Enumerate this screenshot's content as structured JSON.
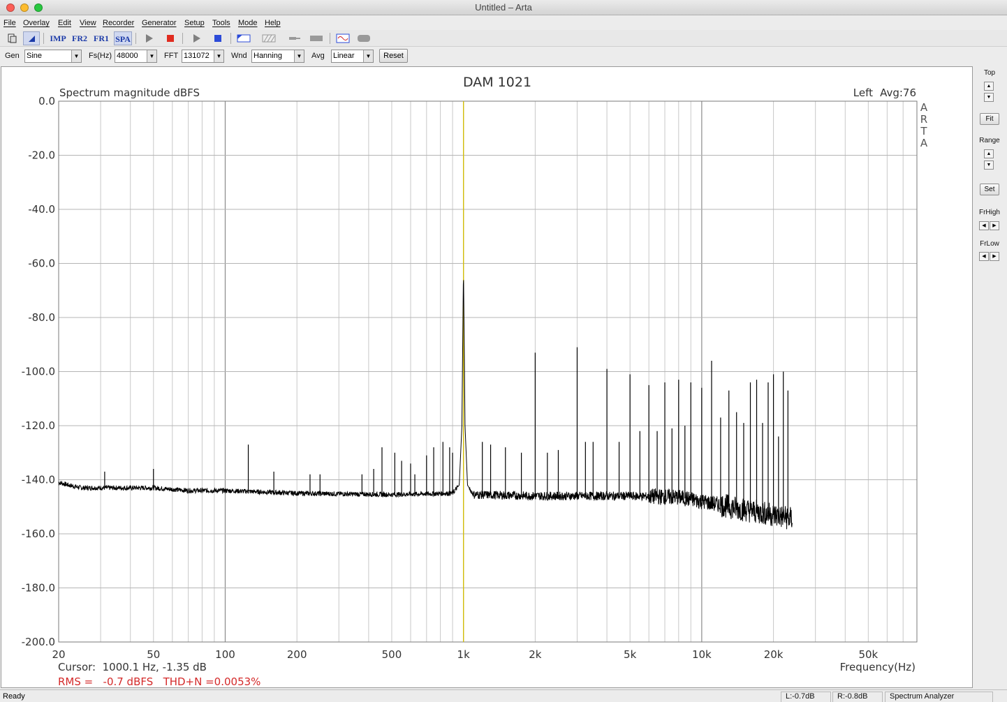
{
  "window": {
    "title": "Untitled – Arta"
  },
  "menu": [
    "File",
    "Overlay",
    "Edit",
    "View",
    "Recorder",
    "Generator",
    "Setup",
    "Tools",
    "Mode",
    "Help"
  ],
  "toolbar": {
    "buttons": [
      "new-icon",
      "pointer-icon",
      "IMP",
      "FR2",
      "FR1",
      "SPA",
      "play-icon",
      "stop-icon",
      "play-icon",
      "stop-icon",
      "abc-icon",
      "hatch-icon",
      "probe-icon",
      "bar-icon",
      "scope-icon",
      "record-icon"
    ],
    "imp": "IMP",
    "fr2": "FR2",
    "fr1": "FR1",
    "spa": "SPA"
  },
  "controls": {
    "gen_label": "Gen",
    "gen_value": "Sine",
    "fs_label": "Fs(Hz)",
    "fs_value": "48000",
    "fft_label": "FFT",
    "fft_value": "131072",
    "wnd_label": "Wnd",
    "wnd_value": "Hanning",
    "avg_label": "Avg",
    "avg_value": "Linear",
    "reset_label": "Reset"
  },
  "right_panel": {
    "top_label": "Top",
    "fit_label": "Fit",
    "range_label": "Range",
    "set_label": "Set",
    "frhigh_label": "FrHigh",
    "frlow_label": "FrLow"
  },
  "status": {
    "ready": "Ready",
    "left_level": "L:-0.7dB",
    "right_level": "R:-0.8dB",
    "mode": "Spectrum Analyzer"
  },
  "chart_data": {
    "type": "line",
    "title": "DAM 1021",
    "ylabel": "Spectrum magnitude dBFS",
    "xlabel": "Frequency(Hz)",
    "channel_label": "Left",
    "avg_label": "Avg:76",
    "watermark": [
      "A",
      "R",
      "T",
      "A"
    ],
    "x_scale": "log",
    "xlim": [
      20,
      80000
    ],
    "ylim": [
      -200,
      0
    ],
    "y_ticks": [
      "0.0",
      "-20.0",
      "-40.0",
      "-60.0",
      "-80.0",
      "-100.0",
      "-120.0",
      "-140.0",
      "-160.0",
      "-180.0",
      "-200.0"
    ],
    "x_ticks": [
      {
        "v": 20,
        "label": "20"
      },
      {
        "v": 50,
        "label": "50"
      },
      {
        "v": 100,
        "label": "100"
      },
      {
        "v": 200,
        "label": "200"
      },
      {
        "v": 500,
        "label": "500"
      },
      {
        "v": 1000,
        "label": "1k"
      },
      {
        "v": 2000,
        "label": "2k"
      },
      {
        "v": 5000,
        "label": "5k"
      },
      {
        "v": 10000,
        "label": "10k"
      },
      {
        "v": 20000,
        "label": "20k"
      },
      {
        "v": 50000,
        "label": "50k"
      }
    ],
    "grid": true,
    "cursor_freq": 1000.1,
    "cursor_text": "Cursor:  1000.1 Hz, -1.35 dB",
    "rms_text": "RMS =   -0.7 dBFS   THD+N =0.0053%",
    "noise_floor": [
      [
        20,
        -141
      ],
      [
        22,
        -142
      ],
      [
        25,
        -143
      ],
      [
        30,
        -143
      ],
      [
        40,
        -143
      ],
      [
        50,
        -143
      ],
      [
        70,
        -144
      ],
      [
        100,
        -144
      ],
      [
        200,
        -145
      ],
      [
        500,
        -145.5
      ],
      [
        900,
        -145
      ],
      [
        960,
        -142
      ],
      [
        985,
        -120
      ],
      [
        995,
        -80
      ],
      [
        1000,
        -62
      ],
      [
        1005,
        -80
      ],
      [
        1015,
        -120
      ],
      [
        1040,
        -142
      ],
      [
        1100,
        -145.5
      ],
      [
        2000,
        -146
      ],
      [
        5000,
        -146
      ],
      [
        8000,
        -146.5
      ],
      [
        10000,
        -148
      ],
      [
        15000,
        -151
      ],
      [
        20000,
        -153
      ],
      [
        24000,
        -154.5
      ]
    ],
    "peaks": [
      [
        31.2,
        -137
      ],
      [
        50,
        -136
      ],
      [
        125,
        -127
      ],
      [
        160,
        -137
      ],
      [
        227,
        -138
      ],
      [
        250,
        -138
      ],
      [
        375,
        -138
      ],
      [
        420,
        -136
      ],
      [
        455,
        -128
      ],
      [
        515,
        -130
      ],
      [
        550,
        -133
      ],
      [
        600,
        -134
      ],
      [
        625,
        -138
      ],
      [
        700,
        -131
      ],
      [
        750,
        -128
      ],
      [
        820,
        -126
      ],
      [
        875,
        -128
      ],
      [
        900,
        -130
      ],
      [
        1000,
        -62
      ],
      [
        1200,
        -126
      ],
      [
        1300,
        -127
      ],
      [
        1500,
        -128
      ],
      [
        1750,
        -130
      ],
      [
        2000,
        -93
      ],
      [
        2250,
        -130
      ],
      [
        2500,
        -129
      ],
      [
        3000,
        -91
      ],
      [
        3250,
        -126
      ],
      [
        3500,
        -126
      ],
      [
        4000,
        -99
      ],
      [
        4500,
        -126
      ],
      [
        5000,
        -101
      ],
      [
        5500,
        -122
      ],
      [
        6000,
        -105
      ],
      [
        6500,
        -122
      ],
      [
        7000,
        -104
      ],
      [
        7500,
        -121
      ],
      [
        8000,
        -103
      ],
      [
        8500,
        -120
      ],
      [
        9000,
        -104
      ],
      [
        10000,
        -106
      ],
      [
        11000,
        -96
      ],
      [
        12000,
        -117
      ],
      [
        13000,
        -107
      ],
      [
        14000,
        -115
      ],
      [
        15000,
        -119
      ],
      [
        16000,
        -104
      ],
      [
        17000,
        -103
      ],
      [
        18000,
        -119
      ],
      [
        19000,
        -104
      ],
      [
        20000,
        -101
      ],
      [
        21000,
        -124
      ],
      [
        22000,
        -100
      ],
      [
        23000,
        -107
      ]
    ]
  }
}
